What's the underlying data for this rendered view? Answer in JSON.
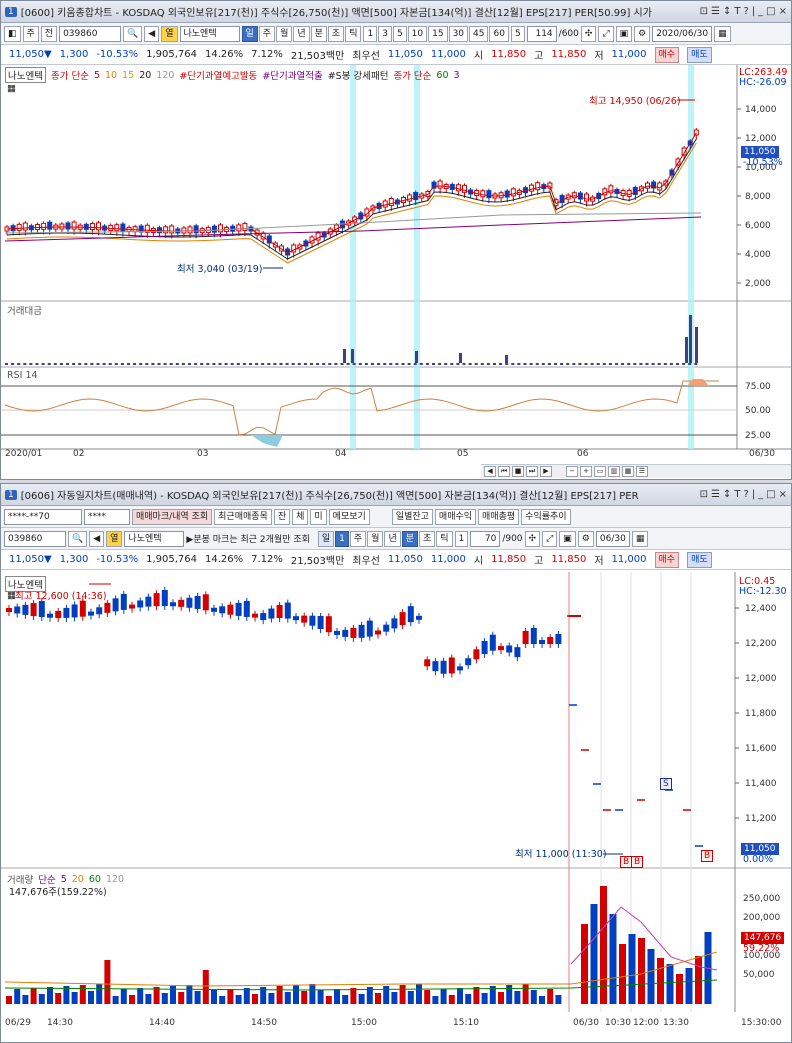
{
  "top": {
    "title_num": "1",
    "title": "[0600] 키움종합차트 - KOSDAQ 외국인보유[217(천)] 주식수[26,750(천)] 액면[500] 자본금[134(억)] 결산[12월] EPS[217] PER[50.99] 시가",
    "title_btns": [
      "⊡",
      "☰",
      "↕",
      "T",
      "?",
      "|",
      "_",
      "□",
      "×"
    ],
    "tb": {
      "period_kind": "주",
      "period_sel": "전",
      "code": "039860",
      "name": "나노엔텍",
      "hot": "열",
      "intervals": [
        "일",
        "주",
        "월",
        "년",
        "분",
        "초",
        "틱"
      ],
      "minutes": [
        "1",
        "3",
        "5",
        "10",
        "15",
        "30",
        "45",
        "60"
      ],
      "count_sel": "5",
      "count": "114",
      "total": "/600",
      "date": "2020/06/30"
    },
    "price": {
      "price": "11,050▼",
      "change": "1,300",
      "rate": "-10.53%",
      "volume": "1,905,764",
      "turnover": "14.26%",
      "ratio": "7.12%",
      "amount": "21,503백만",
      "best_label": "최우선",
      "bid": "11,050",
      "ask": "11,000",
      "open_label": "시",
      "open": "11,850",
      "high_label": "고",
      "high": "11,850",
      "low_label": "저",
      "low": "11,000",
      "buy": "매수",
      "sell": "매도"
    },
    "legend": {
      "name": "나노엔텍",
      "ma_label": "종가 단순",
      "ma": [
        "5",
        "10",
        "15",
        "20",
        "120"
      ],
      "tag1": "#단기과열예고발동",
      "tag2": "#단기과열적출",
      "tag3": "#S봉 강세패턴",
      "tag4_label": "종가 단순",
      "tag4": [
        "60",
        "3"
      ]
    },
    "lc": "LC:263.49",
    "hc": "HC:-26.09",
    "max_label": "최고 14,950 (06/26)",
    "min_label": "최저 3,040 (03/19)",
    "cur_price": "11,050",
    "cur_rate": "-10.53%",
    "yticks": [
      "14,000",
      "12,000",
      "10,000",
      "8,000",
      "6,000",
      "4,000",
      "2,000"
    ],
    "vol_label": "거래대금",
    "rsi_label": "RSI 14",
    "rsi_ticks": [
      "75.00",
      "50.00",
      "25.00"
    ],
    "xlabels": [
      "2020/01",
      "02",
      "03",
      "04",
      "05",
      "06"
    ],
    "xend": "06/30"
  },
  "bot": {
    "title_num": "1",
    "title": "[0606] 자동일지차트(매매내역) - KOSDAQ 외국인보유[217(천)] 주식수[26,750(천)] 액면[500] 자본금[134(억)] 결산[12월] EPS[217] PER",
    "title_btns": [
      "⊡",
      "☰",
      "↕",
      "T",
      "?",
      "|",
      "_",
      "□",
      "×"
    ],
    "tb1": {
      "account": "****-**70",
      "pwd": "****",
      "btn_trade": "매매마크/내역 조회",
      "btn_recent": "최근매매종목",
      "f1": "잔",
      "f2": "체",
      "f3": "미",
      "memo": "메모보기",
      "daily": "일별잔고",
      "profit": "매매수익",
      "total": "매매총평",
      "rate": "수익률추이"
    },
    "tb2": {
      "code": "039860",
      "hot": "열",
      "name": "나노엔텍",
      "notice": "▶분봉 마크는 최근 2개월만 조회",
      "intervals": [
        "일",
        "1",
        "주",
        "월",
        "년",
        "분",
        "초",
        "틱"
      ],
      "tick_sel": "1",
      "count": "70",
      "total": "/900",
      "date": "06/30"
    },
    "price": {
      "price": "11,050▼",
      "change": "1,300",
      "rate": "-10.53%",
      "volume": "1,905,764",
      "turnover": "14.26%",
      "ratio": "7.12%",
      "amount": "21,503백만",
      "best_label": "최우선",
      "bid": "11,050",
      "ask": "11,000",
      "open_label": "시",
      "open": "11,850",
      "high_label": "고",
      "high": "11,850",
      "low_label": "저",
      "low": "11,000",
      "buy": "매수",
      "sell": "매도"
    },
    "legend": {
      "name": "나노엔텍"
    },
    "lc": "LC:0.45",
    "hc": "HC:-12.30",
    "max_label": "최고 12,600 (14:36)",
    "min_label": "최저 11,000 (11:30)",
    "cur_price": "11,050",
    "cur_rate": "0.00%",
    "yticks": [
      "12,400",
      "12,200",
      "12,000",
      "11,800",
      "11,600",
      "11,400",
      "11,200"
    ],
    "vol_legend": {
      "label": "거래량",
      "ma_label": "단순",
      "ma": [
        "5",
        "20",
        "60",
        "120"
      ],
      "value": "147,676주(159.22%)"
    },
    "vol_ticks": [
      "250,000",
      "200,000",
      "150,000",
      "100,000",
      "50,000"
    ],
    "vol_cur": "147,676",
    "vol_cur_rate": "59.22%",
    "xlabels": [
      "06/29",
      "14:30",
      "14:40",
      "14:50",
      "15:00",
      "15:10",
      "06/30",
      "10:30",
      "12:00",
      "13:30"
    ],
    "xend": "15:30:00",
    "marks": {
      "s": "S",
      "b": "B"
    }
  }
}
